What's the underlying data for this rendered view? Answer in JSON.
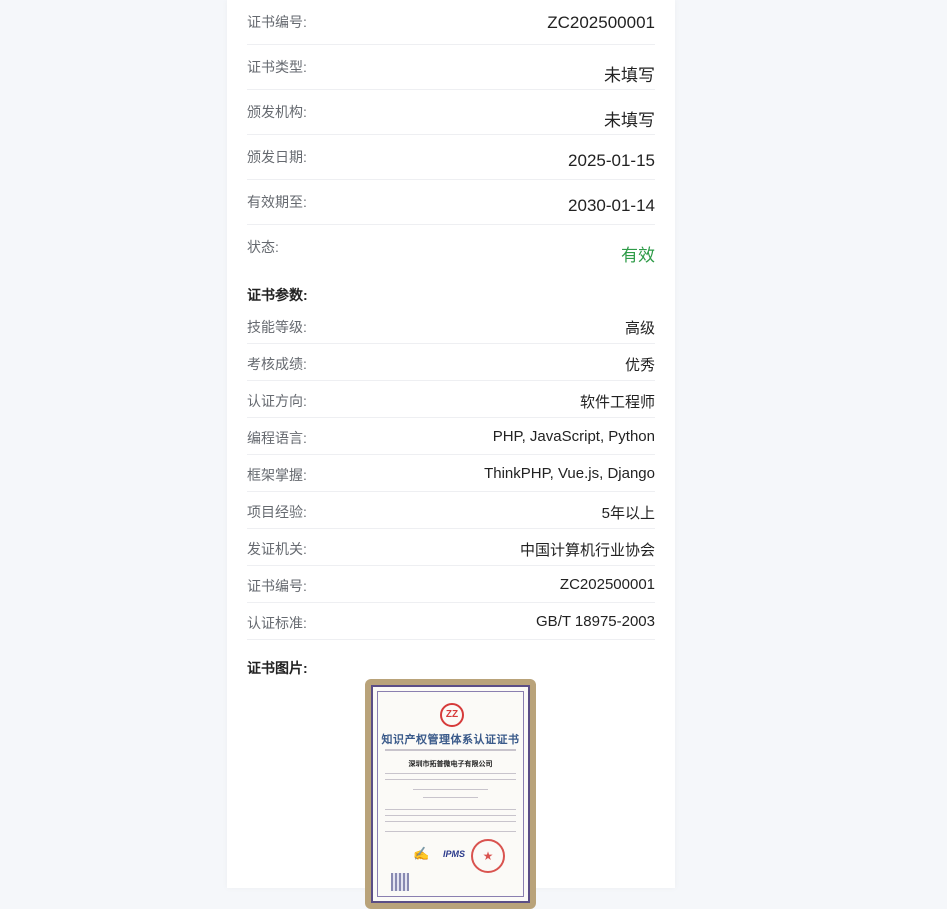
{
  "info_rows": [
    {
      "label": "证书编号:",
      "value": "ZC202500001"
    },
    {
      "label": "证书类型:",
      "value": "未填写"
    },
    {
      "label": "颁发机构:",
      "value": "未填写"
    },
    {
      "label": "颁发日期:",
      "value": "2025-01-15"
    },
    {
      "label": "有效期至:",
      "value": "2030-01-14"
    },
    {
      "label": "状态:",
      "value": "有效"
    }
  ],
  "status_color": "#2e9b48",
  "params": {
    "title": "证书参数:",
    "rows": [
      {
        "label": "技能等级:",
        "value": "高级"
      },
      {
        "label": "考核成绩:",
        "value": "优秀"
      },
      {
        "label": "认证方向:",
        "value": "软件工程师"
      },
      {
        "label": "编程语言:",
        "value": "PHP, JavaScript, Python"
      },
      {
        "label": "框架掌握:",
        "value": "ThinkPHP, Vue.js, Django"
      },
      {
        "label": "项目经验:",
        "value": "5年以上"
      },
      {
        "label": "发证机关:",
        "value": "中国计算机行业协会"
      },
      {
        "label": "证书编号:",
        "value": "ZC202500001"
      },
      {
        "label": "认证标准:",
        "value": "GB/T 18975-2003"
      }
    ]
  },
  "image_section": {
    "title": "证书图片:",
    "cert_logo": "ZZ",
    "cert_title": "知识产权管理体系认证证书",
    "cert_company": "深圳市拓普微电子有限公司",
    "cert_ipms": "IPMS"
  }
}
